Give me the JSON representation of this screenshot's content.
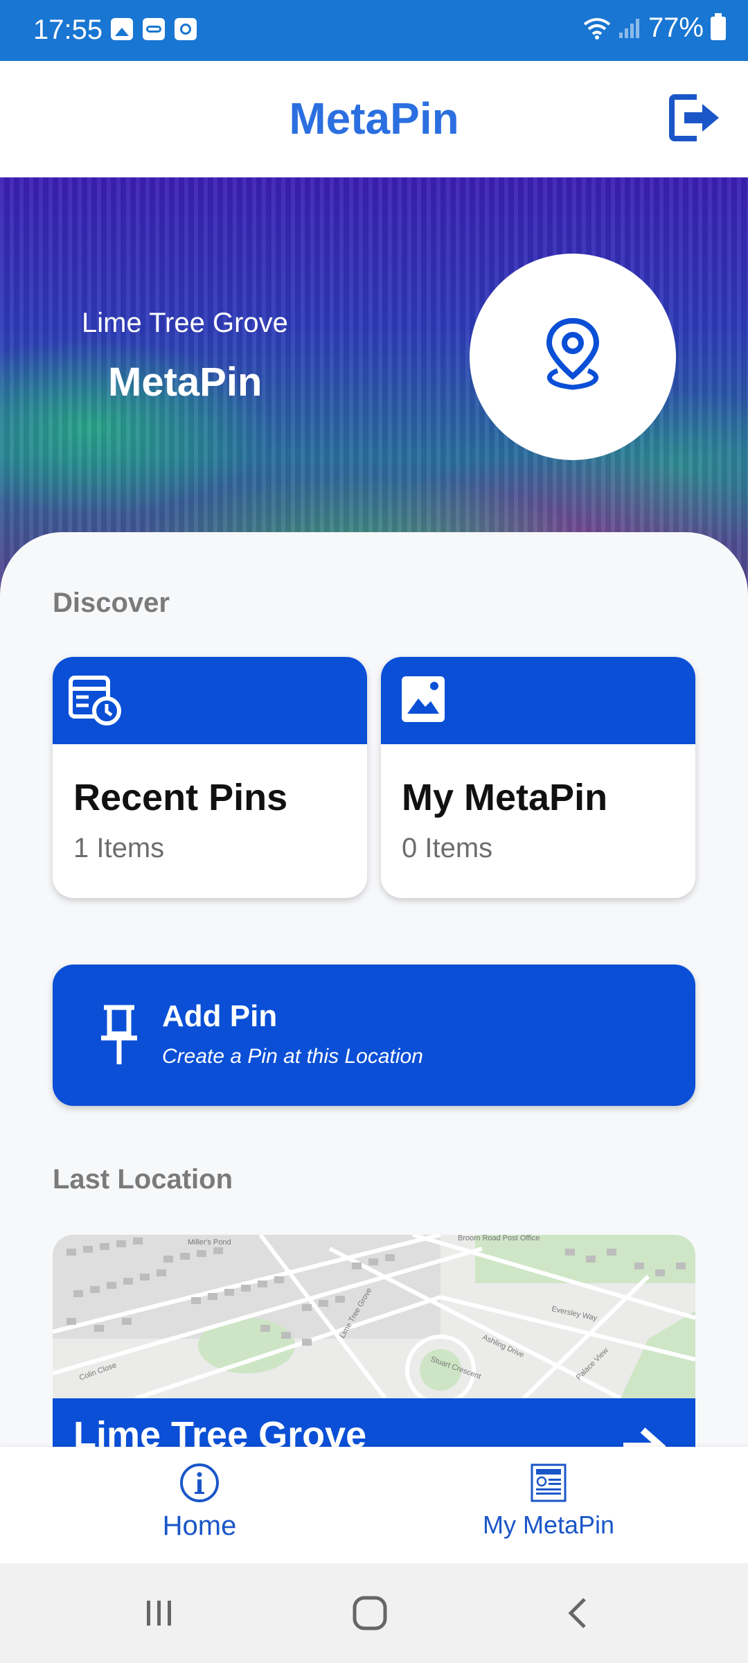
{
  "status_bar": {
    "time": "17:55",
    "battery": "77%"
  },
  "app_bar": {
    "title": "MetaPin"
  },
  "hero": {
    "subtitle": "Lime Tree Grove",
    "title": "MetaPin"
  },
  "discover": {
    "title": "Discover",
    "cards": [
      {
        "title": "Recent Pins",
        "count": "1 Items",
        "icon": "calendar-clock-icon"
      },
      {
        "title": "My MetaPin",
        "count": "0 Items",
        "icon": "image-icon"
      }
    ]
  },
  "add_pin": {
    "title": "Add Pin",
    "subtitle": "Create a Pin at this Location"
  },
  "last_location": {
    "title": "Last Location",
    "place": "Lime Tree Grove",
    "map_labels": [
      "Miller's Pond",
      "Broom Road Post Office",
      "Stuart Crescent",
      "Colin Close",
      "Eversley Way",
      "Palace View",
      "Ashling Drive",
      "Lime Tree Grove"
    ]
  },
  "bottom_nav": {
    "home": "Home",
    "my": "My MetaPin"
  },
  "colors": {
    "primary": "#0a4fd6",
    "status": "#1976d2",
    "title": "#2b6fe0"
  }
}
